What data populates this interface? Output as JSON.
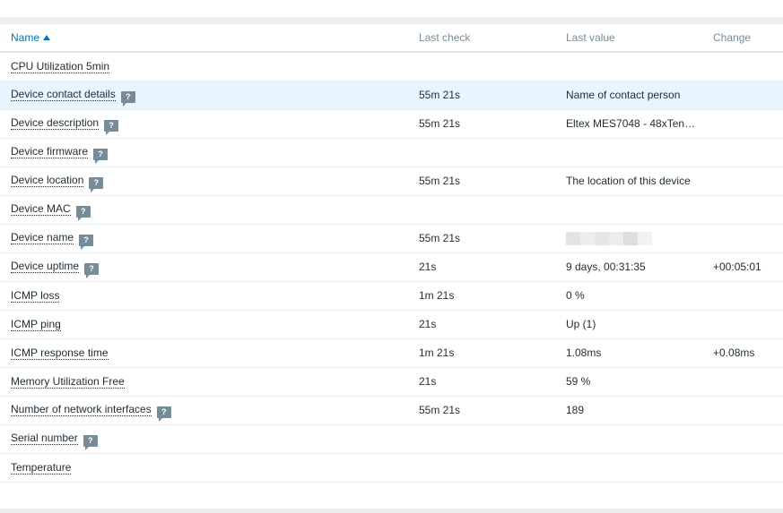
{
  "table": {
    "columns": {
      "name": "Name",
      "last_check": "Last check",
      "last_value": "Last value",
      "change": "Change"
    },
    "sort": {
      "column": "name",
      "direction": "ascending"
    },
    "rows": [
      {
        "name": "CPU Utilization 5min",
        "hint": false,
        "last_check": "",
        "last_value": "",
        "change": ""
      },
      {
        "name": "Device contact details",
        "hint": true,
        "hint_glyph": "?",
        "last_check": "55m 21s",
        "last_value": "Name of contact person",
        "change": ""
      },
      {
        "name": "Device description",
        "hint": true,
        "hint_glyph": "?",
        "last_check": "55m 21s",
        "last_value": "Eltex MES7048 - 48xTenG…",
        "change": ""
      },
      {
        "name": "Device firmware",
        "hint": true,
        "hint_glyph": "?",
        "last_check": "",
        "last_value": "",
        "change": ""
      },
      {
        "name": "Device location",
        "hint": true,
        "hint_glyph": "?",
        "last_check": "55m 21s",
        "last_value": "The location of this device",
        "change": ""
      },
      {
        "name": "Device MAC",
        "hint": true,
        "hint_glyph": "?",
        "last_check": "",
        "last_value": "",
        "change": ""
      },
      {
        "name": "Device name",
        "hint": true,
        "hint_glyph": "?",
        "last_check": "55m 21s",
        "last_value": "",
        "value_redacted": true,
        "change": ""
      },
      {
        "name": "Device uptime",
        "hint": true,
        "hint_glyph": "?",
        "last_check": "21s",
        "last_value": "9 days, 00:31:35",
        "change": "+00:05:01"
      },
      {
        "name": "ICMP loss",
        "hint": false,
        "last_check": "1m 21s",
        "last_value": "0 %",
        "change": ""
      },
      {
        "name": "ICMP ping",
        "hint": false,
        "last_check": "21s",
        "last_value": "Up (1)",
        "change": ""
      },
      {
        "name": "ICMP response time",
        "hint": false,
        "last_check": "1m 21s",
        "last_value": "1.08ms",
        "change": "+0.08ms"
      },
      {
        "name": "Memory Utilization Free",
        "hint": false,
        "last_check": "21s",
        "last_value": "59 %",
        "change": ""
      },
      {
        "name": "Number of network interfaces",
        "hint": true,
        "hint_glyph": "?",
        "last_check": "55m 21s",
        "last_value": "189",
        "change": ""
      },
      {
        "name": "Serial number",
        "hint": true,
        "hint_glyph": "?",
        "last_check": "",
        "last_value": "",
        "change": ""
      },
      {
        "name": "Temperature",
        "hint": false,
        "last_check": "",
        "last_value": "",
        "change": ""
      }
    ],
    "highlighted_row": 1
  },
  "colors": {
    "link": "#0275b8",
    "header_text": "#768d99",
    "row_highlight": "#e8f5ff",
    "hint_icon": "#768d99"
  },
  "icons": {
    "sort": "sort-ascending-icon",
    "hint": "help-hint-icon"
  }
}
